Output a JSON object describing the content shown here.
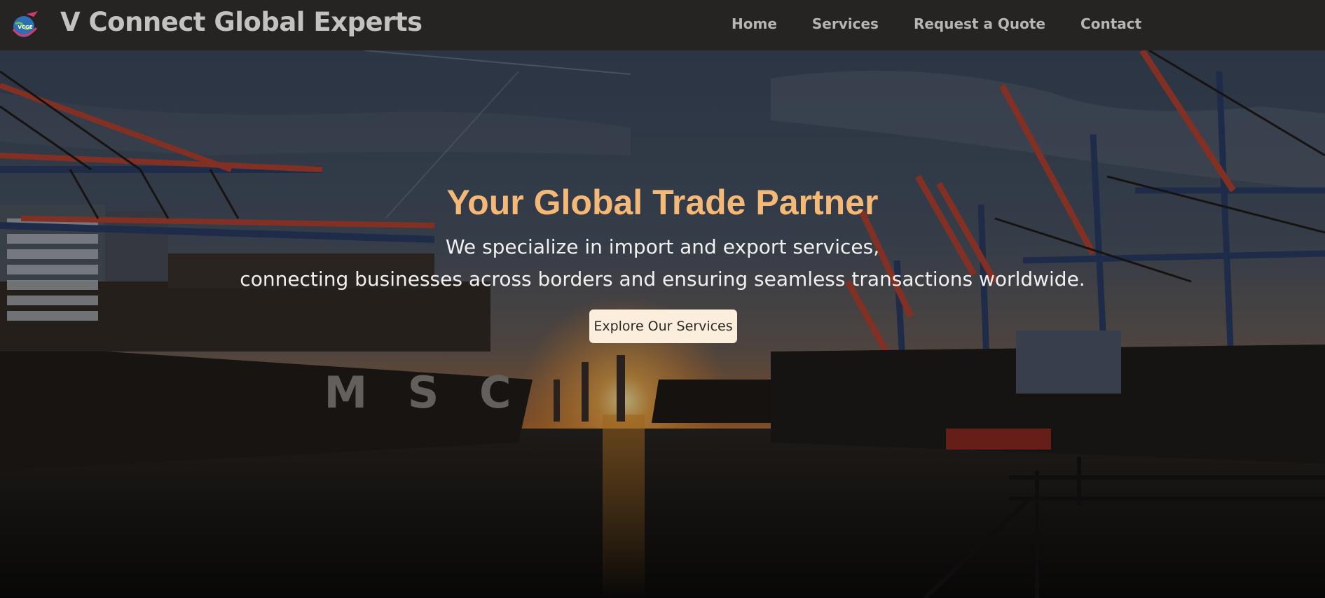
{
  "header": {
    "brand_title": "V Connect Global Experts",
    "logo_text": "VCGE",
    "nav": [
      {
        "label": "Home"
      },
      {
        "label": "Services"
      },
      {
        "label": "Request a Quote"
      },
      {
        "label": "Contact"
      }
    ]
  },
  "hero": {
    "title": "Your Global Trade Partner",
    "subtitle_line1": "We specialize in import and export services,",
    "subtitle_line2": "connecting businesses across borders and ensuring seamless transactions worldwide.",
    "cta_label": "Explore Our Services",
    "ship_hull_lettering": "M S C"
  },
  "colors": {
    "nav_background": "#262422",
    "brand_text": "#c4c1be",
    "hero_title": "#f4b877",
    "cta_background": "#fbeedc"
  },
  "icons": {
    "logo": "globe-airplane-logo-icon"
  }
}
